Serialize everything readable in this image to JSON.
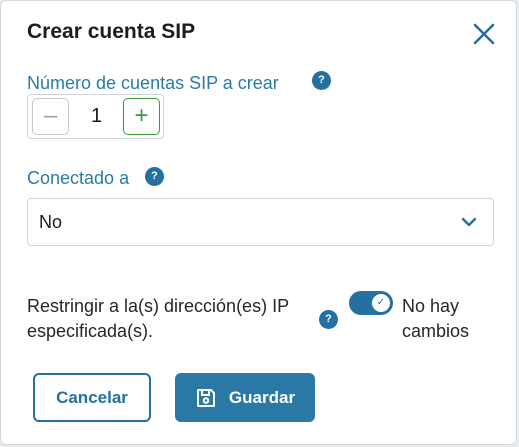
{
  "dialog": {
    "title": "Crear cuenta SIP",
    "close_icon": "close-icon"
  },
  "sip_count": {
    "label": "Número de cuentas SIP a crear",
    "help": "?",
    "value": "1",
    "decrement_symbol": "–",
    "increment_symbol": "+"
  },
  "connected_to": {
    "label": "Conectado a",
    "help": "?",
    "selected": "No",
    "chevron_icon": "chevron-down-icon"
  },
  "restrict_ip": {
    "label": "Restringir a la(s) dirección(es) IP especificada(s).",
    "help": "?",
    "toggle_on": true,
    "toggle_check": "✓",
    "status": "No hay cambios"
  },
  "buttons": {
    "cancel": "Cancelar",
    "save": "Guardar",
    "save_icon": "save-icon"
  },
  "colors": {
    "primary": "#2470a0",
    "label": "#2a7ba6",
    "increment": "#3a9a3a"
  }
}
